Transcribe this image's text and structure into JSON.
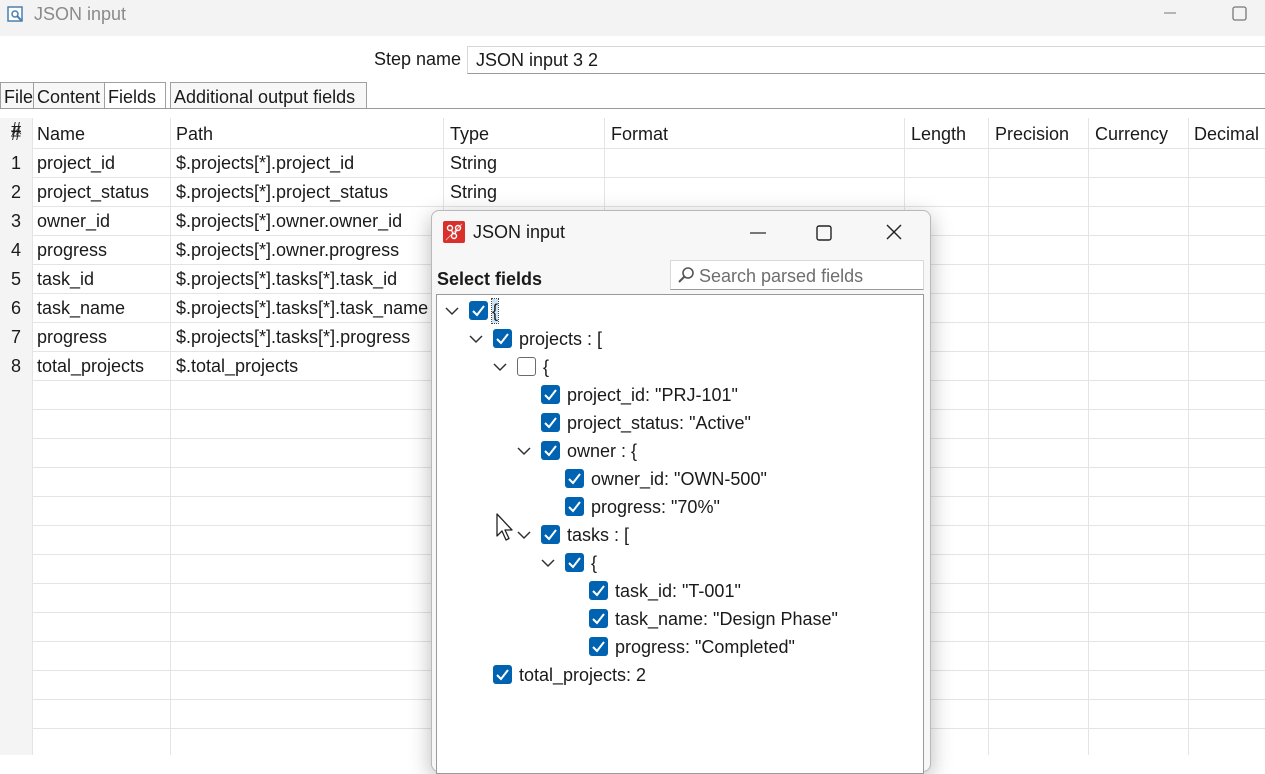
{
  "window": {
    "title": "JSON input"
  },
  "step": {
    "label": "Step name",
    "value": "JSON input 3 2"
  },
  "tabs": [
    {
      "label": "File"
    },
    {
      "label": "Content"
    },
    {
      "label": "Fields"
    },
    {
      "label": "Additional output fields"
    }
  ],
  "table": {
    "headers": [
      "#",
      "Name",
      "Path",
      "Type",
      "Format",
      "Length",
      "Precision",
      "Currency",
      "Decimal"
    ],
    "rows": [
      {
        "num": "1",
        "name": "project_id",
        "path": "$.projects[*].project_id",
        "type": "String"
      },
      {
        "num": "2",
        "name": "project_status",
        "path": "$.projects[*].project_status",
        "type": "String"
      },
      {
        "num": "3",
        "name": "owner_id",
        "path": "$.projects[*].owner.owner_id",
        "type": ""
      },
      {
        "num": "4",
        "name": "progress",
        "path": "$.projects[*].owner.progress",
        "type": ""
      },
      {
        "num": "5",
        "name": "task_id",
        "path": "$.projects[*].tasks[*].task_id",
        "type": ""
      },
      {
        "num": "6",
        "name": "task_name",
        "path": "$.projects[*].tasks[*].task_name",
        "type": ""
      },
      {
        "num": "7",
        "name": "progress",
        "path": "$.projects[*].tasks[*].progress",
        "type": ""
      },
      {
        "num": "8",
        "name": "total_projects",
        "path": "$.total_projects",
        "type": ""
      }
    ]
  },
  "dialog": {
    "title": "JSON input",
    "select_label": "Select fields",
    "search_placeholder": "Search parsed fields",
    "tree": [
      {
        "label": "{",
        "checked": true,
        "expanded": true,
        "selected": true
      },
      {
        "label": "projects : [",
        "checked": true,
        "expanded": true
      },
      {
        "label": "{",
        "checked": false,
        "expanded": true
      },
      {
        "label": "project_id: \"PRJ-101\"",
        "checked": true
      },
      {
        "label": "project_status: \"Active\"",
        "checked": true
      },
      {
        "label": "owner : {",
        "checked": true,
        "expanded": true
      },
      {
        "label": "owner_id: \"OWN-500\"",
        "checked": true
      },
      {
        "label": "progress: \"70%\"",
        "checked": true
      },
      {
        "label": "tasks : [",
        "checked": true,
        "expanded": true
      },
      {
        "label": "{",
        "checked": true,
        "expanded": true
      },
      {
        "label": "task_id: \"T-001\"",
        "checked": true
      },
      {
        "label": "task_name: \"Design Phase\"",
        "checked": true
      },
      {
        "label": "progress: \"Completed\"",
        "checked": true
      },
      {
        "label": "total_projects: 2",
        "checked": true
      }
    ]
  },
  "colors": {
    "checkbox_accent": "#0063b1",
    "app_icon_red": "#d9302c"
  }
}
